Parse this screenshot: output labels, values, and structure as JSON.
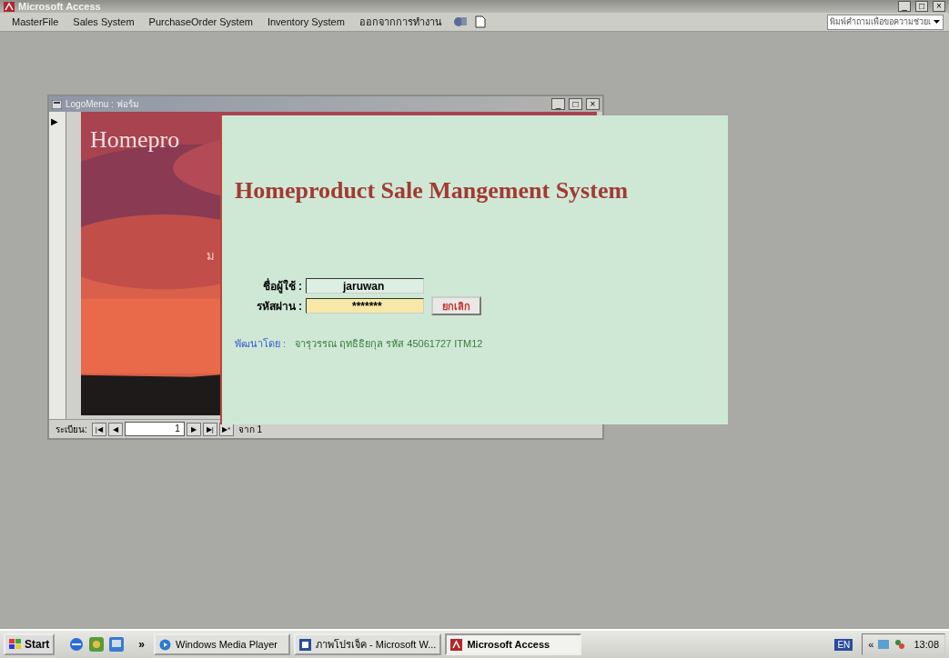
{
  "window": {
    "title": "Microsoft Access",
    "controls": [
      "_",
      "□",
      "×"
    ]
  },
  "menu_bar": {
    "items": [
      "MasterFile",
      "Sales System",
      "PurchaseOrder System",
      "Inventory System",
      "ออกจากการทำงาน"
    ],
    "help_box": {
      "placeholder": "พิมพ์คำถามเพื่อขอความช่วยเ"
    }
  },
  "form_window": {
    "title": "LogoMenu : ฟอร์ม",
    "controls": [
      "_",
      "□",
      "×"
    ],
    "record_selector": "▶",
    "picture_text": "Homepro",
    "picture_subtext": "ม",
    "navigation": {
      "label": "ระเบียน:",
      "first": "|◀",
      "prev": "◀",
      "record": "1",
      "next": "▶",
      "last": "▶|",
      "new": "▶*",
      "count": "จาก 1"
    }
  },
  "login_dialog": {
    "title": "Homeproduct Sale Mangement System",
    "username_label": "ชื่อผู้ใช้ :",
    "username": "jaruwan",
    "password_label": "รหัสผ่าน :",
    "password": "*******",
    "cancel_button": "ยกเลิก",
    "credit_label": "พัฒนาโดย :",
    "credit": "จารุวรรณ ฤทธิธิยกุล รหัส 45061727 ITM12"
  },
  "taskbar": {
    "start": "Start",
    "overflow": "»",
    "buttons": [
      {
        "label": "Windows Media Player",
        "kind": "media",
        "selected": false
      },
      {
        "label": "ภาพโปรเจ็ค - Microsoft W...",
        "kind": "doc",
        "selected": false
      },
      {
        "label": "Microsoft Access",
        "kind": "access",
        "selected": true
      }
    ],
    "language": "EN",
    "tray_expand": "«",
    "clock": "13:08"
  }
}
